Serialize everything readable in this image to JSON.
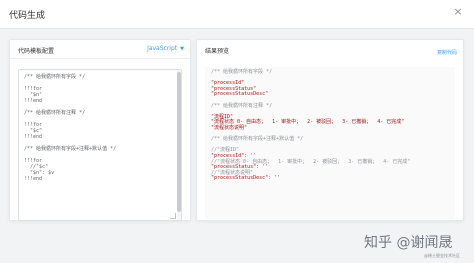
{
  "dialog": {
    "title": "代码生成",
    "close_glyph": "×"
  },
  "left_panel": {
    "title": "代码模板配置",
    "language_selected": "JavaScript",
    "code_lines": [
      "/** 给我循环所有字段 */",
      "",
      "!!!for",
      "  \"$n\"",
      "!!!end",
      "",
      "/** 给我循环所有注释 */",
      "",
      "!!!for",
      "  \"$c\"",
      "!!!end",
      "",
      "/** 给我循环所有字段+注释+默认值 */",
      "",
      "!!!for",
      "  //\"$c\"",
      "  \"$n\": $v",
      "!!!end"
    ]
  },
  "right_panel": {
    "title": "结果预览",
    "copy_label": "复制代码",
    "result_lines": [
      {
        "cls": "cm",
        "text": "/** 给我循环所有字段 */"
      },
      {
        "cls": "",
        "text": ""
      },
      {
        "cls": "str",
        "text": "\"processId\""
      },
      {
        "cls": "str",
        "text": "\"processStatus\""
      },
      {
        "cls": "str",
        "text": "\"processStatusDesc\""
      },
      {
        "cls": "",
        "text": ""
      },
      {
        "cls": "cm",
        "text": "/** 给我循环所有注释 */"
      },
      {
        "cls": "",
        "text": ""
      },
      {
        "cls": "str",
        "text": "\"流程ID\""
      },
      {
        "cls": "str",
        "text": "\"流程状态 0- 自由态；  1- 审批中；  2- 被驳回；  3- 已撤销；  4- 已完成\""
      },
      {
        "cls": "str",
        "text": "\"流程状态说明\""
      },
      {
        "cls": "",
        "text": ""
      },
      {
        "cls": "cm",
        "text": "/** 给我循环所有字段+注释+默认值 */"
      },
      {
        "cls": "",
        "text": ""
      },
      {
        "cls": "cm",
        "text": "//\"流程ID\""
      },
      {
        "cls": "str",
        "text": "\"processId\": ''"
      },
      {
        "cls": "cm",
        "text": "//\"流程状态 0- 自由态；  1- 审批中；  2- 被驳回；  3- 已撤销；  4- 已完成\""
      },
      {
        "cls": "str",
        "text": "\"processStatus\": ''"
      },
      {
        "cls": "cm",
        "text": "//\"流程状态说明\""
      },
      {
        "cls": "str",
        "text": "\"processStatusDesc\": ''"
      }
    ]
  },
  "watermark": {
    "text": "知乎 @谢闻晟",
    "subtext": "@稀土掘金技术社区"
  }
}
